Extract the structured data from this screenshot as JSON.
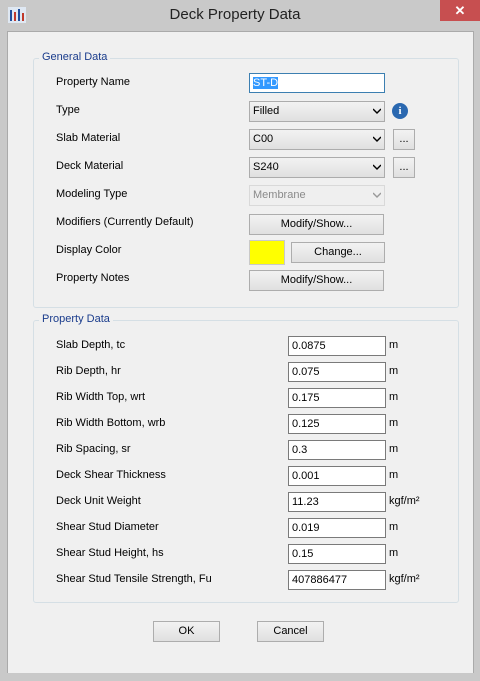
{
  "window": {
    "title": "Deck Property Data",
    "close_glyph": "✕"
  },
  "general": {
    "title": "General Data",
    "property_name": {
      "label": "Property Name",
      "value": "ST-D"
    },
    "type": {
      "label": "Type",
      "value": "Filled"
    },
    "slab_material": {
      "label": "Slab Material",
      "value": "C00",
      "browse": "..."
    },
    "deck_material": {
      "label": "Deck Material",
      "value": "S240",
      "browse": "..."
    },
    "modeling_type": {
      "label": "Modeling Type",
      "value": "Membrane"
    },
    "modifiers": {
      "label": "Modifiers (Currently Default)",
      "button": "Modify/Show..."
    },
    "display_color": {
      "label": "Display Color",
      "button": "Change...",
      "color": "#ffff00"
    },
    "notes": {
      "label": "Property Notes",
      "button": "Modify/Show..."
    }
  },
  "property": {
    "title": "Property Data",
    "rows": [
      {
        "label": "Slab Depth, tc",
        "value": "0.0875",
        "unit": "m"
      },
      {
        "label": "Rib Depth, hr",
        "value": "0.075",
        "unit": "m"
      },
      {
        "label": "Rib Width Top, wrt",
        "value": "0.175",
        "unit": "m"
      },
      {
        "label": "Rib Width Bottom, wrb",
        "value": "0.125",
        "unit": "m"
      },
      {
        "label": "Rib Spacing, sr",
        "value": "0.3",
        "unit": "m"
      },
      {
        "label": "Deck Shear Thickness",
        "value": "0.001",
        "unit": "m"
      },
      {
        "label": "Deck Unit Weight",
        "value": "11.23",
        "unit": "kgf/m²"
      },
      {
        "label": "Shear Stud Diameter",
        "value": "0.019",
        "unit": "m"
      },
      {
        "label": "Shear Stud Height, hs",
        "value": "0.15",
        "unit": "m"
      },
      {
        "label": "Shear Stud Tensile Strength, Fu",
        "value": "407886477",
        "unit": "kgf/m²"
      }
    ]
  },
  "buttons": {
    "ok": "OK",
    "cancel": "Cancel"
  }
}
